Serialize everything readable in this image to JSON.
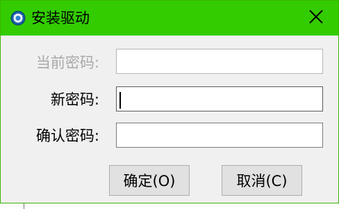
{
  "window": {
    "title": "安装驱动",
    "icon": "app-globe-icon",
    "close_icon": "close-icon",
    "titlebar_color": "#33cc00"
  },
  "form": {
    "current_password_label": "当前密码:",
    "current_password_value": "",
    "new_password_label": "新密码:",
    "new_password_value": "",
    "confirm_password_label": "确认密码:",
    "confirm_password_value": ""
  },
  "buttons": {
    "ok_label": "确定(O)",
    "cancel_label": "取消(C)"
  }
}
